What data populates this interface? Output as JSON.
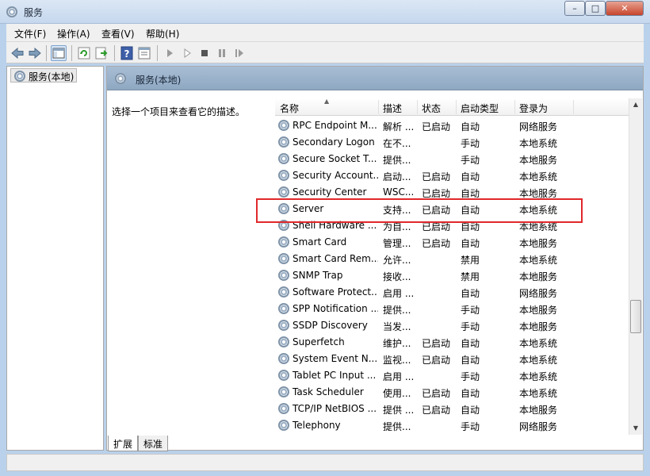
{
  "window": {
    "title": "服务",
    "min_label": "–",
    "max_label": "□",
    "close_label": "✕"
  },
  "menu": [
    "文件(F)",
    "操作(A)",
    "查看(V)",
    "帮助(H)"
  ],
  "toolbar": {
    "buttons": [
      "back-icon",
      "forward-icon",
      "show-hide-tree-icon",
      "refresh-icon",
      "export-list-icon",
      "help-icon",
      "properties-icon",
      "start-service-icon",
      "start-service-params-icon",
      "stop-service-icon",
      "pause-service-icon",
      "resume-service-icon"
    ]
  },
  "tree": {
    "root_label": "服务(本地)"
  },
  "panel": {
    "header_title": "服务(本地)",
    "description_text": "选择一个项目来查看它的描述。"
  },
  "table": {
    "columns": [
      "名称",
      "描述",
      "状态",
      "启动类型",
      "登录为"
    ],
    "rows": [
      {
        "name": "RPC Endpoint M...",
        "desc": "解析 ...",
        "status": "已启动",
        "startup": "自动",
        "logon": "网络服务"
      },
      {
        "name": "Secondary Logon",
        "desc": "在不...",
        "status": "",
        "startup": "手动",
        "logon": "本地系统"
      },
      {
        "name": "Secure Socket T...",
        "desc": "提供...",
        "status": "",
        "startup": "手动",
        "logon": "本地服务"
      },
      {
        "name": "Security Account...",
        "desc": "启动...",
        "status": "已启动",
        "startup": "自动",
        "logon": "本地系统"
      },
      {
        "name": "Security Center",
        "desc": "WSC...",
        "status": "已启动",
        "startup": "自动",
        "logon": "本地服务"
      },
      {
        "name": "Server",
        "desc": "支持...",
        "status": "已启动",
        "startup": "自动",
        "logon": "本地系统"
      },
      {
        "name": "Shell Hardware ...",
        "desc": "为自...",
        "status": "已启动",
        "startup": "自动",
        "logon": "本地系统"
      },
      {
        "name": "Smart Card",
        "desc": "管理...",
        "status": "已启动",
        "startup": "自动",
        "logon": "本地服务"
      },
      {
        "name": "Smart Card Rem...",
        "desc": "允许...",
        "status": "",
        "startup": "禁用",
        "logon": "本地系统"
      },
      {
        "name": "SNMP Trap",
        "desc": "接收...",
        "status": "",
        "startup": "禁用",
        "logon": "本地服务"
      },
      {
        "name": "Software Protect...",
        "desc": "启用 ...",
        "status": "",
        "startup": "自动",
        "logon": "网络服务"
      },
      {
        "name": "SPP Notification ...",
        "desc": "提供...",
        "status": "",
        "startup": "手动",
        "logon": "本地服务"
      },
      {
        "name": "SSDP Discovery",
        "desc": "当发...",
        "status": "",
        "startup": "手动",
        "logon": "本地服务"
      },
      {
        "name": "Superfetch",
        "desc": "维护...",
        "status": "已启动",
        "startup": "自动",
        "logon": "本地系统"
      },
      {
        "name": "System Event N...",
        "desc": "监视...",
        "status": "已启动",
        "startup": "自动",
        "logon": "本地系统"
      },
      {
        "name": "Tablet PC Input ...",
        "desc": "启用 ...",
        "status": "",
        "startup": "手动",
        "logon": "本地系统"
      },
      {
        "name": "Task Scheduler",
        "desc": "使用...",
        "status": "已启动",
        "startup": "自动",
        "logon": "本地系统"
      },
      {
        "name": "TCP/IP NetBIOS ...",
        "desc": "提供 ...",
        "status": "已启动",
        "startup": "自动",
        "logon": "本地服务"
      },
      {
        "name": "Telephony",
        "desc": "提供...",
        "status": "",
        "startup": "手动",
        "logon": "网络服务"
      }
    ]
  },
  "tabs": [
    "扩展",
    "标准"
  ],
  "colors": {
    "highlight": "#e0282b",
    "panel_header": "#9bb3cb"
  }
}
